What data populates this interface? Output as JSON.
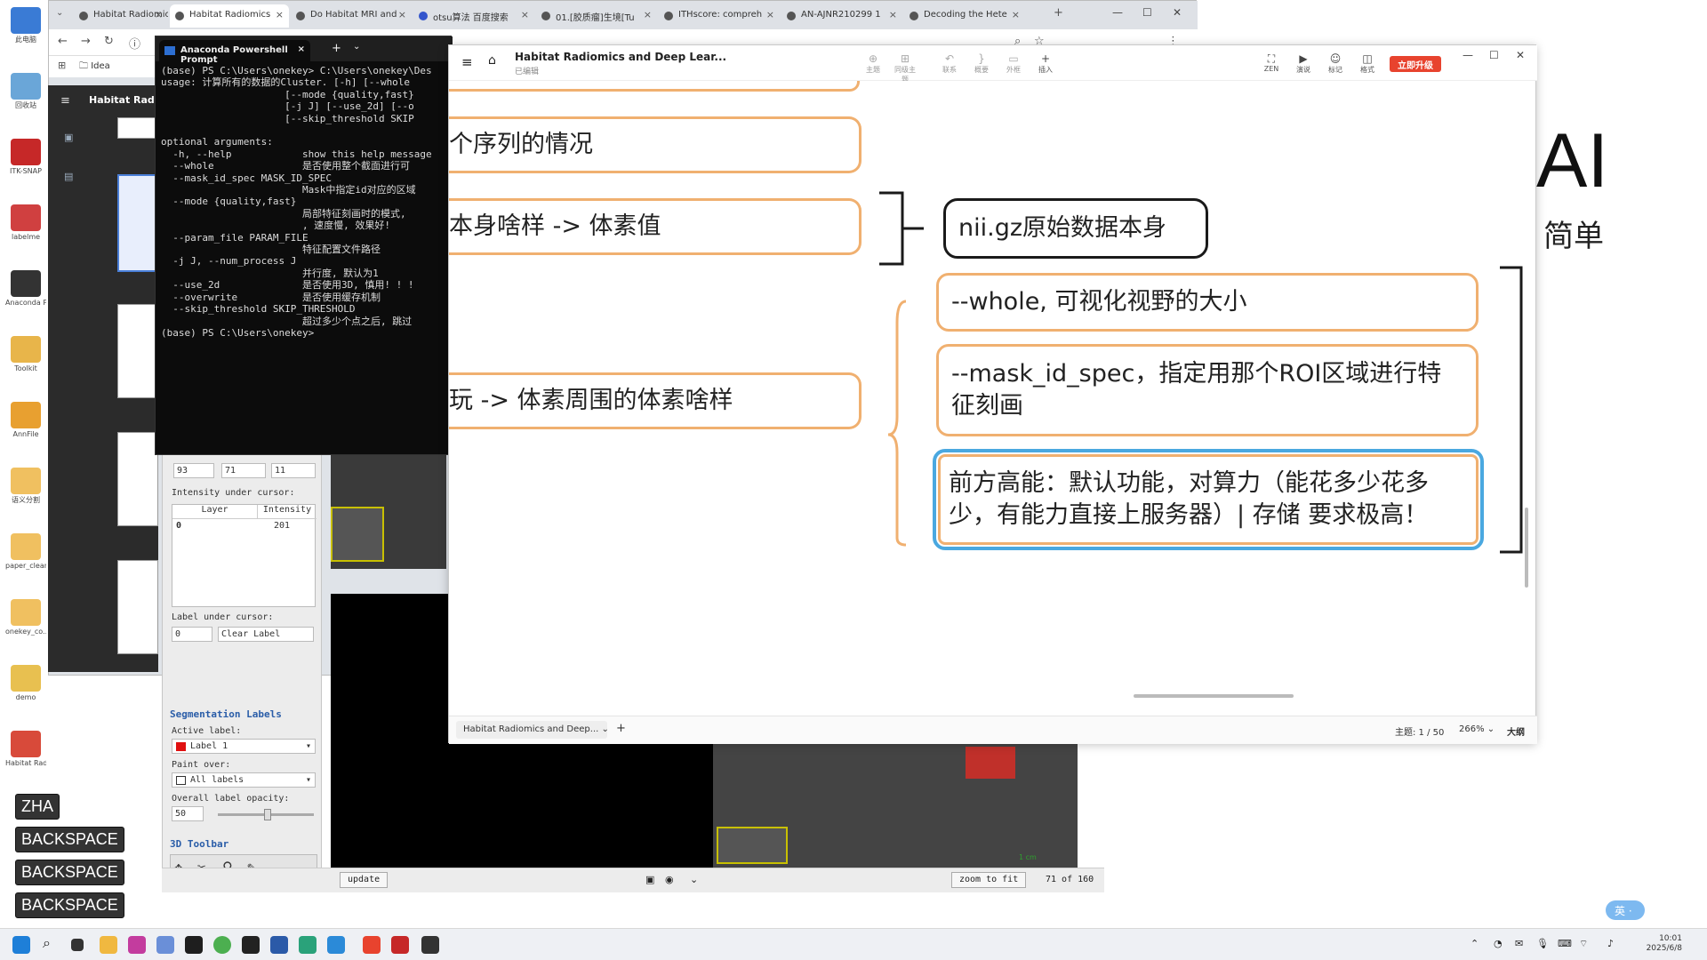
{
  "desktop": {
    "icons": [
      {
        "label": "此电脑",
        "color": "#3a7bd5"
      },
      {
        "label": "回收站",
        "color": "#6aa6d8"
      },
      {
        "label": "ITK-SNAP",
        "color": "#c62828"
      },
      {
        "label": "labelme",
        "color": "#d04040"
      },
      {
        "label": "Anaconda Powersh...",
        "color": "#333333"
      },
      {
        "label": "Toolkit",
        "color": "#e8b54a"
      },
      {
        "label": "AnnFile",
        "color": "#e8a030"
      },
      {
        "label": "语义分割",
        "color": "#f0c060"
      },
      {
        "label": "paper_clean",
        "color": "#f0c060"
      },
      {
        "label": "onekey_co...",
        "color": "#f0c060"
      },
      {
        "label": "demo",
        "color": "#e8c050"
      },
      {
        "label": "Habitat Radiomics...",
        "color": "#d84a3a"
      }
    ],
    "keys": [
      "ZHA",
      "BACKSPACE",
      "BACKSPACE",
      "BACKSPACE"
    ],
    "background_text": {
      "ai": "AI",
      "cn": "简单"
    }
  },
  "chrome": {
    "tabs": [
      "Habitat Radiomics",
      "Habitat Radiomics",
      "Do Habitat MRI and",
      "otsu算法 百度搜索",
      "01.[胶质瘤]生境[Tu",
      "ITHscore: compreh",
      "AN-AJNR210299 1",
      "Decoding the Hete"
    ],
    "new_tab": "+",
    "bookmark_items": [
      "Idea"
    ],
    "sidebar_title": "Habitat Radio"
  },
  "powershell": {
    "tab_title": "Anaconda Powershell Prompt",
    "lines": [
      "(base) PS C:\\Users\\onekey> C:\\Users\\onekey\\Des",
      "usage: 计算所有的数据的Cluster. [-h] [--whole",
      "                     [--mode {quality,fast}",
      "                     [-j J] [--use_2d] [--o",
      "                     [--skip_threshold SKIP",
      "",
      "optional arguments:",
      "  -h, --help            show this help message",
      "  --whole               是否使用整个截面进行可",
      "  --mask_id_spec MASK_ID_SPEC",
      "                        Mask中指定id对应的区域",
      "  --mode {quality,fast}",
      "                        局部特征刻画时的模式,",
      "                        , 速度慢, 效果好!",
      "  --param_file PARAM_FILE",
      "                        特征配置文件路径",
      "  -j J, --num_process J",
      "                        并行度, 默认为1",
      "  --use_2d              是否使用3D, 慎用! ! !",
      "  --overwrite           是否使用缓存机制",
      "  --skip_threshold SKIP_THRESHOLD",
      "                        超过多少个点之后, 跳过",
      "(base) PS C:\\Users\\onekey>"
    ]
  },
  "itksnap": {
    "coords": [
      "93",
      "71",
      "11"
    ],
    "intensity_label": "Intensity under cursor:",
    "table_headers": [
      "Layer",
      "Intensity"
    ],
    "table_rows": [
      {
        "layer": "0",
        "intensity": "201"
      }
    ],
    "label_under_cursor": "Label under cursor:",
    "label_value": "0",
    "label_name": "Clear Label",
    "seg_heading": "Segmentation Labels",
    "active_label_title": "Active label:",
    "active_label": "Label 1",
    "paint_over_title": "Paint over:",
    "paint_over": "All labels",
    "opacity_title": "Overall label opacity:",
    "opacity_value": "50",
    "toolbar_3d": "3D Toolbar",
    "update_btn": "update",
    "zoom_btn": "zoom to fit",
    "slice_text": "71 of 160",
    "scale_text": "1 cm"
  },
  "mindmap": {
    "title": "Habitat Radiomics and Deep Lear...",
    "subtitle": "已编辑",
    "tools": [
      {
        "label": "主题",
        "icon": "⊕"
      },
      {
        "label": "同级主题",
        "icon": "⊞"
      },
      {
        "label": "联系",
        "icon": "↶"
      },
      {
        "label": "概要",
        "icon": "}"
      },
      {
        "label": "外框",
        "icon": "▭"
      },
      {
        "label": "插入",
        "icon": "+"
      }
    ],
    "right_tools": [
      {
        "label": "ZEN",
        "icon": "⛶"
      },
      {
        "label": "演说",
        "icon": "▶"
      },
      {
        "label": "标记",
        "icon": "☺"
      },
      {
        "label": "格式",
        "icon": "◫"
      }
    ],
    "upgrade": "立即升级",
    "nodes": {
      "n1": "个序列的情况",
      "n2": "本身啥样 -> 体素值",
      "n3": "玩 -> 体素周围的体素啥样",
      "n4": "nii.gz原始数据本身",
      "n5": "--whole, 可视化视野的大小",
      "n6": "--mask_id_spec，指定用那个ROI区域进行特征刻画",
      "n7": "前方高能：默认功能，对算力（能花多少花多少，有能力直接上服务器）| 存储 要求极高！"
    },
    "doc_tab": "Habitat Radiomics and Deep...",
    "status": {
      "topic": "主题: 1 / 50",
      "zoom": "266%",
      "outline": "大纲"
    },
    "colors": {
      "node_border": "#f0b070",
      "selected_border": "#4aa8e0",
      "dark_border": "#1a1a1a",
      "upgrade": "#e8432e"
    }
  },
  "taskbar": {
    "time": "10:01",
    "date": "2025/6/8",
    "ime": "英"
  }
}
